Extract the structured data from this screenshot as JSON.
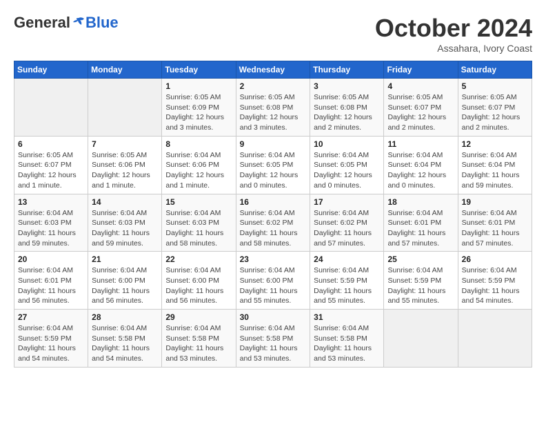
{
  "logo": {
    "general": "General",
    "blue": "Blue"
  },
  "title": "October 2024",
  "subtitle": "Assahara, Ivory Coast",
  "days_header": [
    "Sunday",
    "Monday",
    "Tuesday",
    "Wednesday",
    "Thursday",
    "Friday",
    "Saturday"
  ],
  "weeks": [
    [
      {
        "day": "",
        "info": ""
      },
      {
        "day": "",
        "info": ""
      },
      {
        "day": "1",
        "info": "Sunrise: 6:05 AM\nSunset: 6:09 PM\nDaylight: 12 hours\nand 3 minutes."
      },
      {
        "day": "2",
        "info": "Sunrise: 6:05 AM\nSunset: 6:08 PM\nDaylight: 12 hours\nand 3 minutes."
      },
      {
        "day": "3",
        "info": "Sunrise: 6:05 AM\nSunset: 6:08 PM\nDaylight: 12 hours\nand 2 minutes."
      },
      {
        "day": "4",
        "info": "Sunrise: 6:05 AM\nSunset: 6:07 PM\nDaylight: 12 hours\nand 2 minutes."
      },
      {
        "day": "5",
        "info": "Sunrise: 6:05 AM\nSunset: 6:07 PM\nDaylight: 12 hours\nand 2 minutes."
      }
    ],
    [
      {
        "day": "6",
        "info": "Sunrise: 6:05 AM\nSunset: 6:07 PM\nDaylight: 12 hours\nand 1 minute."
      },
      {
        "day": "7",
        "info": "Sunrise: 6:05 AM\nSunset: 6:06 PM\nDaylight: 12 hours\nand 1 minute."
      },
      {
        "day": "8",
        "info": "Sunrise: 6:04 AM\nSunset: 6:06 PM\nDaylight: 12 hours\nand 1 minute."
      },
      {
        "day": "9",
        "info": "Sunrise: 6:04 AM\nSunset: 6:05 PM\nDaylight: 12 hours\nand 0 minutes."
      },
      {
        "day": "10",
        "info": "Sunrise: 6:04 AM\nSunset: 6:05 PM\nDaylight: 12 hours\nand 0 minutes."
      },
      {
        "day": "11",
        "info": "Sunrise: 6:04 AM\nSunset: 6:04 PM\nDaylight: 12 hours\nand 0 minutes."
      },
      {
        "day": "12",
        "info": "Sunrise: 6:04 AM\nSunset: 6:04 PM\nDaylight: 11 hours\nand 59 minutes."
      }
    ],
    [
      {
        "day": "13",
        "info": "Sunrise: 6:04 AM\nSunset: 6:03 PM\nDaylight: 11 hours\nand 59 minutes."
      },
      {
        "day": "14",
        "info": "Sunrise: 6:04 AM\nSunset: 6:03 PM\nDaylight: 11 hours\nand 59 minutes."
      },
      {
        "day": "15",
        "info": "Sunrise: 6:04 AM\nSunset: 6:03 PM\nDaylight: 11 hours\nand 58 minutes."
      },
      {
        "day": "16",
        "info": "Sunrise: 6:04 AM\nSunset: 6:02 PM\nDaylight: 11 hours\nand 58 minutes."
      },
      {
        "day": "17",
        "info": "Sunrise: 6:04 AM\nSunset: 6:02 PM\nDaylight: 11 hours\nand 57 minutes."
      },
      {
        "day": "18",
        "info": "Sunrise: 6:04 AM\nSunset: 6:01 PM\nDaylight: 11 hours\nand 57 minutes."
      },
      {
        "day": "19",
        "info": "Sunrise: 6:04 AM\nSunset: 6:01 PM\nDaylight: 11 hours\nand 57 minutes."
      }
    ],
    [
      {
        "day": "20",
        "info": "Sunrise: 6:04 AM\nSunset: 6:01 PM\nDaylight: 11 hours\nand 56 minutes."
      },
      {
        "day": "21",
        "info": "Sunrise: 6:04 AM\nSunset: 6:00 PM\nDaylight: 11 hours\nand 56 minutes."
      },
      {
        "day": "22",
        "info": "Sunrise: 6:04 AM\nSunset: 6:00 PM\nDaylight: 11 hours\nand 56 minutes."
      },
      {
        "day": "23",
        "info": "Sunrise: 6:04 AM\nSunset: 6:00 PM\nDaylight: 11 hours\nand 55 minutes."
      },
      {
        "day": "24",
        "info": "Sunrise: 6:04 AM\nSunset: 5:59 PM\nDaylight: 11 hours\nand 55 minutes."
      },
      {
        "day": "25",
        "info": "Sunrise: 6:04 AM\nSunset: 5:59 PM\nDaylight: 11 hours\nand 55 minutes."
      },
      {
        "day": "26",
        "info": "Sunrise: 6:04 AM\nSunset: 5:59 PM\nDaylight: 11 hours\nand 54 minutes."
      }
    ],
    [
      {
        "day": "27",
        "info": "Sunrise: 6:04 AM\nSunset: 5:59 PM\nDaylight: 11 hours\nand 54 minutes."
      },
      {
        "day": "28",
        "info": "Sunrise: 6:04 AM\nSunset: 5:58 PM\nDaylight: 11 hours\nand 54 minutes."
      },
      {
        "day": "29",
        "info": "Sunrise: 6:04 AM\nSunset: 5:58 PM\nDaylight: 11 hours\nand 53 minutes."
      },
      {
        "day": "30",
        "info": "Sunrise: 6:04 AM\nSunset: 5:58 PM\nDaylight: 11 hours\nand 53 minutes."
      },
      {
        "day": "31",
        "info": "Sunrise: 6:04 AM\nSunset: 5:58 PM\nDaylight: 11 hours\nand 53 minutes."
      },
      {
        "day": "",
        "info": ""
      },
      {
        "day": "",
        "info": ""
      }
    ]
  ]
}
